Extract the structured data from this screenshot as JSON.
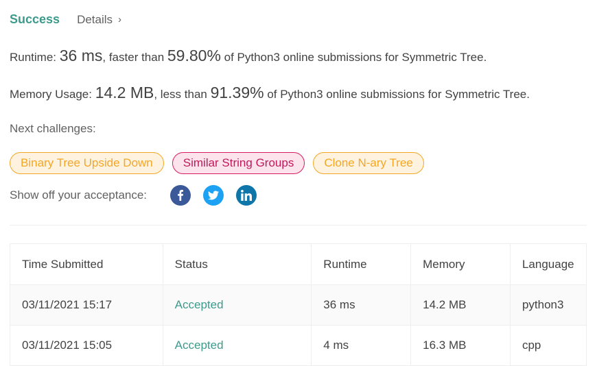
{
  "header": {
    "status": "Success",
    "details_label": "Details"
  },
  "runtime": {
    "prefix": "Runtime: ",
    "value": "36 ms",
    "middle": ", faster than ",
    "percent": "59.80%",
    "suffix": " of Python3 online submissions for Symmetric Tree."
  },
  "memory": {
    "prefix": "Memory Usage: ",
    "value": "14.2 MB",
    "middle": ", less than ",
    "percent": "91.39%",
    "suffix": " of Python3 online submissions for Symmetric Tree."
  },
  "next_challenges": {
    "label": "Next challenges:",
    "items": [
      {
        "label": "Binary Tree Upside Down",
        "difficulty": "medium"
      },
      {
        "label": "Similar String Groups",
        "difficulty": "hard"
      },
      {
        "label": "Clone N-ary Tree",
        "difficulty": "medium"
      }
    ]
  },
  "share": {
    "label": "Show off your acceptance:",
    "icons": [
      "facebook-icon",
      "twitter-icon",
      "linkedin-icon"
    ]
  },
  "colors": {
    "accent": "#3d9a8c",
    "medium": "#f5a623",
    "hard": "#c2185b",
    "facebook": "#3b5998",
    "twitter": "#1da1f2",
    "linkedin": "#0e76a8"
  },
  "submissions": {
    "columns": [
      "Time Submitted",
      "Status",
      "Runtime",
      "Memory",
      "Language"
    ],
    "rows": [
      {
        "time": "03/11/2021 15:17",
        "status": "Accepted",
        "runtime": "36 ms",
        "memory": "14.2 MB",
        "language": "python3"
      },
      {
        "time": "03/11/2021 15:05",
        "status": "Accepted",
        "runtime": "4 ms",
        "memory": "16.3 MB",
        "language": "cpp"
      }
    ]
  }
}
